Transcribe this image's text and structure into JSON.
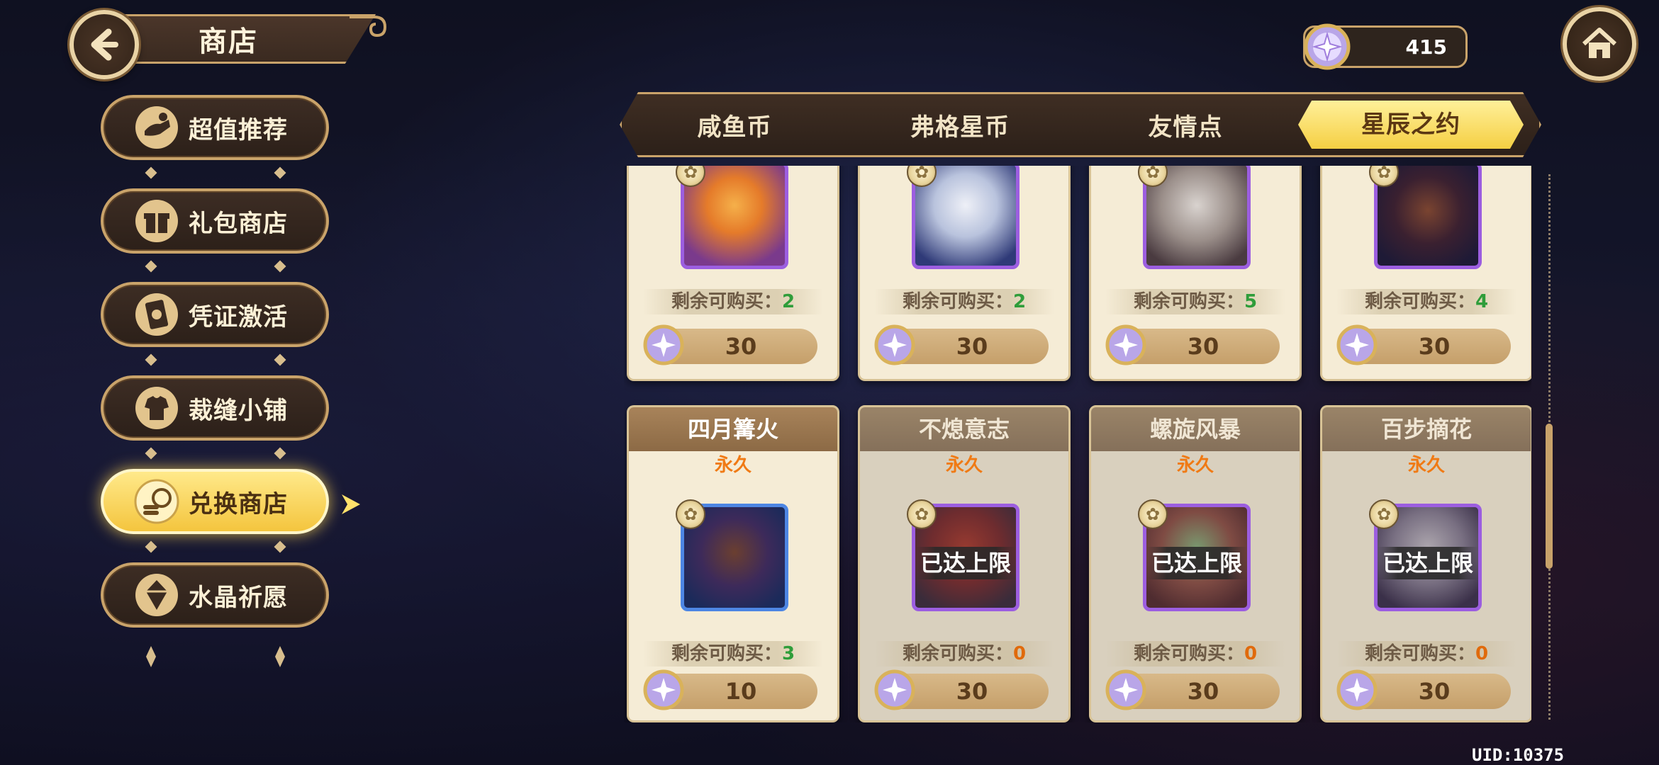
{
  "header": {
    "title": "商店",
    "currency_amount": "415",
    "back_icon": "back-arrow-icon",
    "home_icon": "home-icon",
    "currency_icon": "star-crystal-icon"
  },
  "sidebar": {
    "items": [
      {
        "label": "超值推荐",
        "icon": "hand-gift-icon",
        "active": false
      },
      {
        "label": "礼包商店",
        "icon": "gift-box-icon",
        "active": false
      },
      {
        "label": "凭证激活",
        "icon": "card-icon",
        "active": false
      },
      {
        "label": "裁缝小铺",
        "icon": "tailor-icon",
        "active": false
      },
      {
        "label": "兑换商店",
        "icon": "exchange-icon",
        "active": true
      },
      {
        "label": "水晶祈愿",
        "icon": "crystal-icon",
        "active": false
      }
    ]
  },
  "tabs": [
    {
      "label": "咸鱼币",
      "active": false
    },
    {
      "label": "弗格星币",
      "active": false
    },
    {
      "label": "友情点",
      "active": false
    },
    {
      "label": "星辰之约",
      "active": true
    }
  ],
  "cards_top": [
    {
      "remain_label": "剩余可购买：",
      "remain": "2",
      "price": "30"
    },
    {
      "remain_label": "剩余可购买：",
      "remain": "2",
      "price": "30"
    },
    {
      "remain_label": "剩余可购买：",
      "remain": "5",
      "price": "30"
    },
    {
      "remain_label": "剩余可购买：",
      "remain": "4",
      "price": "30"
    }
  ],
  "cards_bottom": [
    {
      "name": "四月篝火",
      "duration": "永久",
      "remain_label": "剩余可购买：",
      "remain": "3",
      "price": "10",
      "sold_out": false
    },
    {
      "name": "不熄意志",
      "duration": "永久",
      "remain_label": "剩余可购买：",
      "remain": "0",
      "price": "30",
      "sold_out": true,
      "limit_text": "已达上限"
    },
    {
      "name": "螺旋风暴",
      "duration": "永久",
      "remain_label": "剩余可购买：",
      "remain": "0",
      "price": "30",
      "sold_out": true,
      "limit_text": "已达上限"
    },
    {
      "name": "百步摘花",
      "duration": "永久",
      "remain_label": "剩余可购买：",
      "remain": "0",
      "price": "30",
      "sold_out": true,
      "limit_text": "已达上限"
    }
  ],
  "footer": {
    "uid": "UID:10375"
  },
  "colors": {
    "accent_gold": "#f5cf43",
    "remain_green": "#2f9d3a",
    "remain_orange": "#e06a0c",
    "frame_purple": "#9c5ee0",
    "frame_blue": "#4d86e3"
  }
}
